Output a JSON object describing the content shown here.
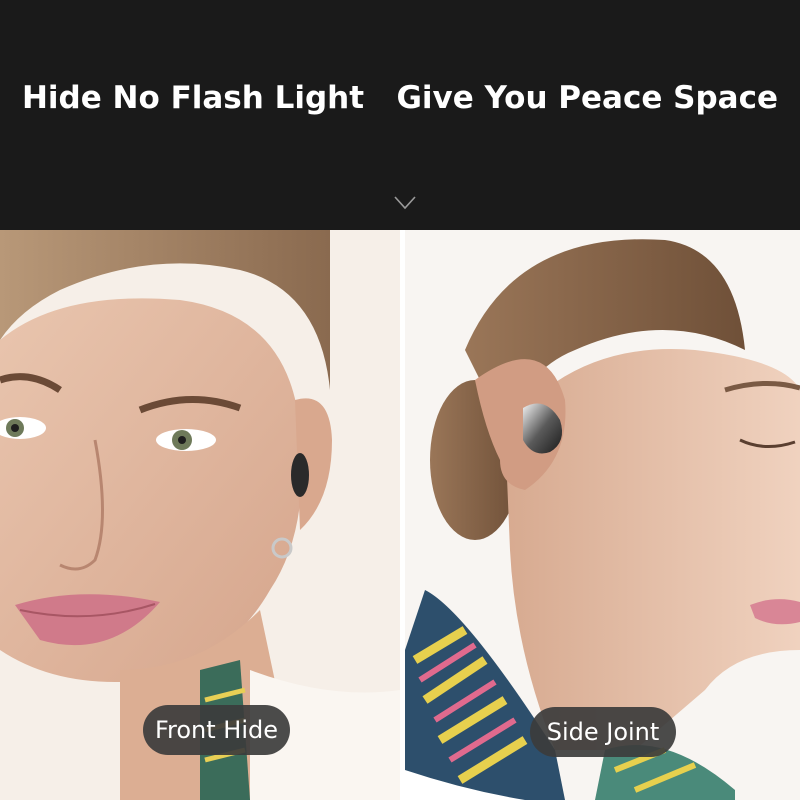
{
  "banner": {
    "headline": "Hide No Flash Light   Give You Peace Space",
    "background_color": "#1a1a1a",
    "arrow_icon": "chevron-down-outline-icon"
  },
  "photos": {
    "left": {
      "caption": "Front Hide"
    },
    "right": {
      "caption": "Side Joint"
    }
  }
}
